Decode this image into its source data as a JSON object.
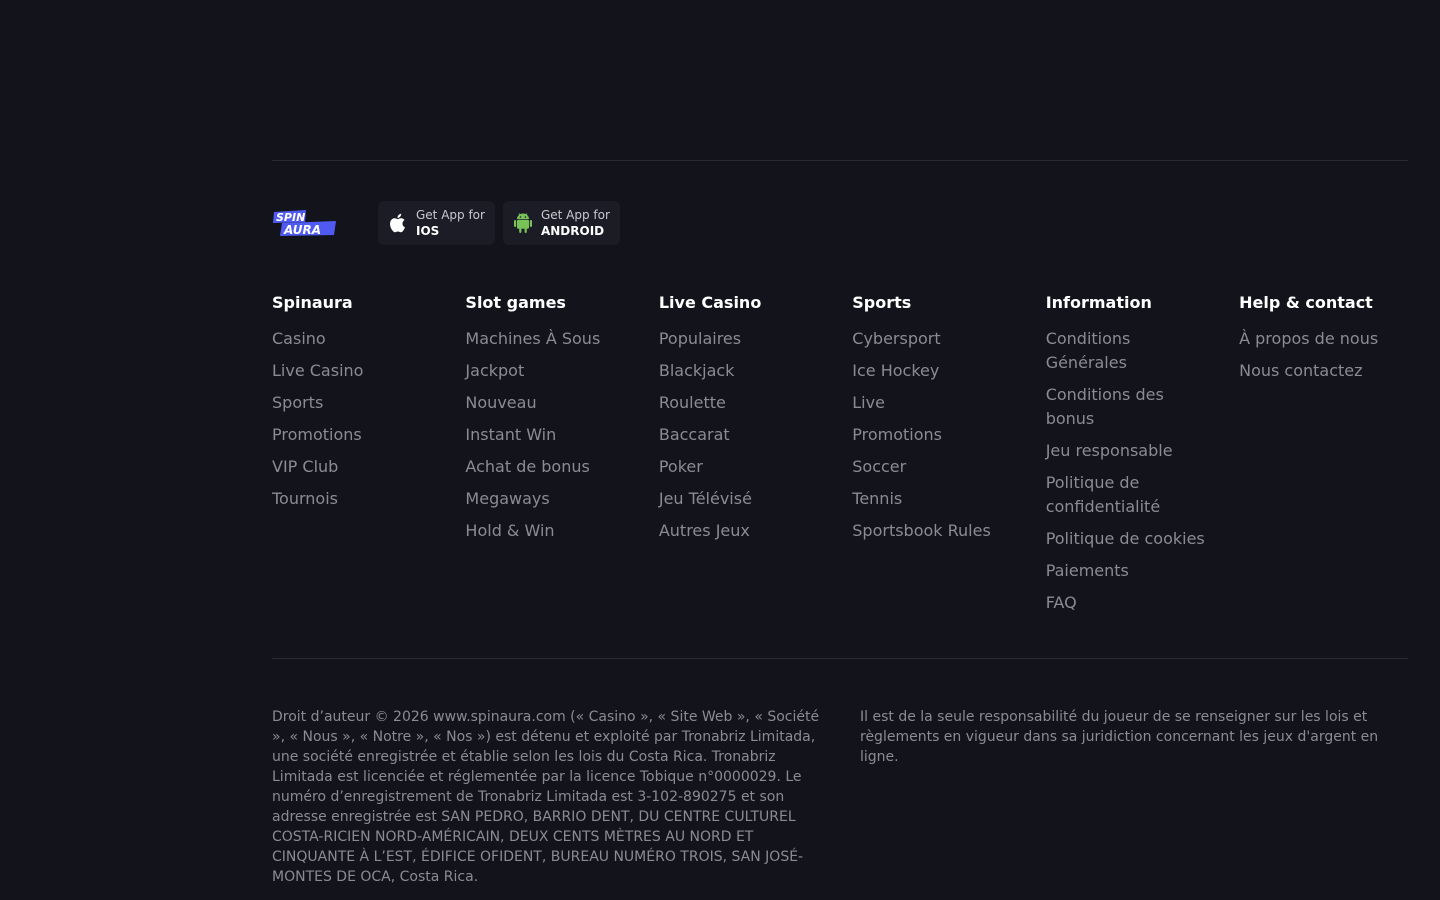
{
  "apps": {
    "ios": {
      "small": "Get App for",
      "big": "IOS"
    },
    "android": {
      "small": "Get App for",
      "big": "ANDROID"
    }
  },
  "colors": {
    "background": "#13131c",
    "logo_blue": "#4f5bf0",
    "android_green": "#78c257"
  },
  "columns": [
    {
      "title": "Spinaura",
      "links": [
        "Casino",
        "Live Casino",
        "Sports",
        "Promotions",
        "VIP Club",
        "Tournois"
      ]
    },
    {
      "title": "Slot games",
      "links": [
        "Machines À Sous",
        "Jackpot",
        "Nouveau",
        "Instant Win",
        "Achat de bonus",
        "Megaways",
        "Hold & Win"
      ]
    },
    {
      "title": "Live Casino",
      "links": [
        "Populaires",
        "Blackjack",
        "Roulette",
        "Baccarat",
        "Poker",
        "Jeu Télévisé",
        "Autres Jeux"
      ]
    },
    {
      "title": "Sports",
      "links": [
        "Cybersport",
        "Ice Hockey",
        "Live",
        "Promotions",
        "Soccer",
        "Tennis",
        "Sportsbook Rules"
      ]
    },
    {
      "title": "Information",
      "links": [
        "Conditions Générales",
        "Conditions des bonus",
        "Jeu responsable",
        "Politique de confidentialité",
        "Politique de cookies",
        "Paiements",
        "FAQ"
      ]
    },
    {
      "title": "Help & contact",
      "links": [
        "À propos de nous",
        "Nous contactez"
      ]
    }
  ],
  "legal": {
    "left": "Droit d’auteur © 2026 www.spinaura.com (« Casino », « Site Web », « Société », « Nous », « Notre », « Nos ») est détenu et exploité par Tronabriz Limitada, une société enregistrée et établie selon les lois du Costa Rica. Tronabriz Limitada est licenciée et réglementée par la licence Tobique n°0000029. Le numéro d’enregistrement de Tronabriz Limitada est 3-102-890275 et son adresse enregistrée est SAN PEDRO, BARRIO DENT, DU CENTRE CULTUREL COSTA-RICIEN NORD-AMÉRICAIN, DEUX CENTS MÈTRES AU NORD ET CINQUANTE À L’EST, ÉDIFICE OFIDENT, BUREAU NUMÉRO TROIS, SAN JOSÉ-MONTES DE OCA, Costa Rica.",
    "right": "Il est de la seule responsabilité du joueur de se renseigner sur les lois et règlements en vigueur dans sa juridiction concernant les jeux d'argent en ligne."
  }
}
